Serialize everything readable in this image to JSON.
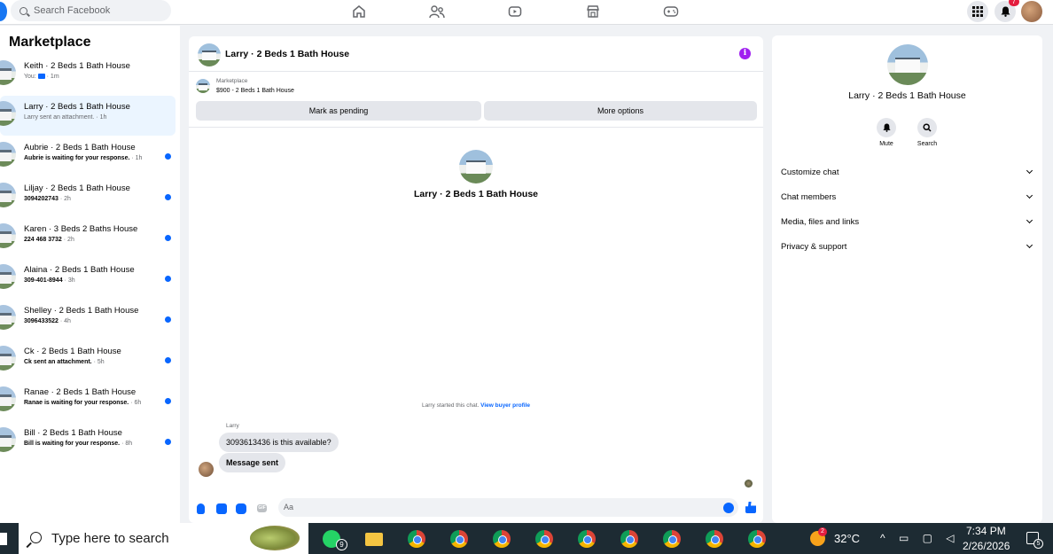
{
  "topbar": {
    "search_placeholder": "Search Facebook",
    "nav_icons": [
      "home-icon",
      "friends-icon",
      "watch-icon",
      "marketplace-icon",
      "gaming-icon"
    ],
    "notification_count": "7",
    "accent": "#1877f2"
  },
  "sidebar": {
    "title": "Marketplace",
    "conversations": [
      {
        "name": "Keith · 2 Beds 1 Bath House",
        "snippet": "You: ",
        "time": " · 1m",
        "unread": false
      },
      {
        "name": "Larry · 2 Beds 1 Bath House",
        "snippet": "Larry sent an attachment.",
        "time": " · 1h",
        "unread": false
      },
      {
        "name": "Aubrie · 2 Beds 1 Bath House",
        "snippet": "Aubrie is waiting for your response.",
        "time": " · 1h",
        "unread": true
      },
      {
        "name": "Liljay · 2 Beds 1 Bath House",
        "snippet": "3094202743",
        "time": " · 2h",
        "unread": true
      },
      {
        "name": "Karen · 3 Beds 2 Baths House",
        "snippet": "224 468 3732",
        "time": " · 2h",
        "unread": true
      },
      {
        "name": "Alaina · 2 Beds 1 Bath House",
        "snippet": "309-401-8944",
        "time": " · 3h",
        "unread": true
      },
      {
        "name": "Shelley · 2 Beds 1 Bath House",
        "snippet": "3096433522",
        "time": " · 4h",
        "unread": true
      },
      {
        "name": "Ck · 2 Beds 1 Bath House",
        "snippet": "Ck sent an attachment.",
        "time": " · 5h",
        "unread": true
      },
      {
        "name": "Ranae · 2 Beds 1 Bath House",
        "snippet": "Ranae is waiting for your response.",
        "time": " · 6h",
        "unread": true
      },
      {
        "name": "Bill · 2 Beds 1 Bath House",
        "snippet": "Bill is waiting for your response.",
        "time": " · 8h",
        "unread": true
      }
    ]
  },
  "chat": {
    "title": "Larry · 2 Beds 1 Bath House",
    "marketplace_label": "Marketplace",
    "item": "$900 - 2 Beds 1 Bath House",
    "mark_pending": "Mark as pending",
    "more_options": "More options",
    "center_title": "Larry · 2 Beds 1 Bath House",
    "started_text": "Larry started this chat.",
    "view_buyer": "View buyer profile",
    "sender": "Larry",
    "message1": "3093613436 is this available?",
    "message2": "Message sent",
    "input_placeholder": "Aa",
    "gif_label": "GIF"
  },
  "details": {
    "title": "Larry · 2 Beds 1 Bath House",
    "mute": "Mute",
    "search": "Search",
    "sections": [
      "Customize chat",
      "Chat members",
      "Media, files and links",
      "Privacy & support"
    ]
  },
  "taskbar": {
    "search_placeholder": "Type here to search",
    "whatsapp_badge": "9",
    "weather_badge": "2",
    "temperature": "32°C",
    "tray_icons": "^ ▭ ▢ ◁",
    "time": "7:34 PM",
    "date": "2/26/2026",
    "notification_badge": "5"
  }
}
